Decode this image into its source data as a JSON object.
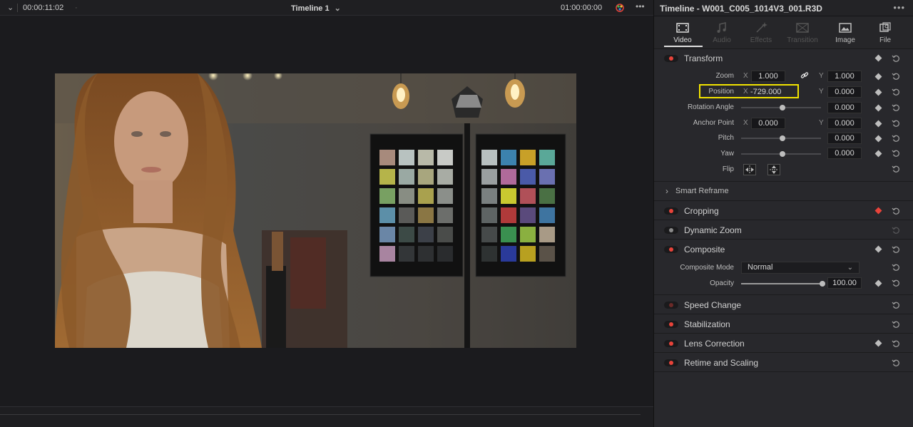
{
  "viewer": {
    "left_dropdown_chevron": "⌄",
    "timecode_left": "00:00:11:02",
    "timeline_name": "Timeline 1",
    "timeline_chevron": "⌄",
    "timecode_right": "01:00:00:00",
    "menu_dots": "•••"
  },
  "inspector": {
    "title": "Timeline - W001_C005_1014V3_001.R3D",
    "menu_dots": "•••",
    "tabs": [
      {
        "label": "Video",
        "icon": "film-icon",
        "state": "active"
      },
      {
        "label": "Audio",
        "icon": "music-note-icon",
        "state": "disabled"
      },
      {
        "label": "Effects",
        "icon": "magic-wand-icon",
        "state": "disabled"
      },
      {
        "label": "Transition",
        "icon": "transition-icon",
        "state": "disabled"
      },
      {
        "label": "Image",
        "icon": "image-icon",
        "state": "enabled"
      },
      {
        "label": "File",
        "icon": "file-icon",
        "state": "enabled"
      }
    ],
    "transform": {
      "label": "Transform",
      "zoom_label": "Zoom",
      "zoom_x_axis": "X",
      "zoom_x": "1.000",
      "zoom_y_axis": "Y",
      "zoom_y": "1.000",
      "position_label": "Position",
      "position_x_axis": "X",
      "position_x": "-729.000",
      "position_y_axis": "Y",
      "position_y": "0.000",
      "rotation_label": "Rotation Angle",
      "rotation": "0.000",
      "anchor_label": "Anchor Point",
      "anchor_x_axis": "X",
      "anchor_x": "0.000",
      "anchor_y_axis": "Y",
      "anchor_y": "0.000",
      "pitch_label": "Pitch",
      "pitch": "0.000",
      "yaw_label": "Yaw",
      "yaw": "0.000",
      "flip_label": "Flip"
    },
    "smart_reframe": {
      "label": "Smart Reframe",
      "chevron": "›"
    },
    "cropping": {
      "label": "Cropping"
    },
    "dynamic_zoom": {
      "label": "Dynamic Zoom"
    },
    "composite": {
      "label": "Composite",
      "mode_label": "Composite Mode",
      "mode_value": "Normal",
      "chevron": "⌄",
      "opacity_label": "Opacity",
      "opacity": "100.00"
    },
    "speed_change": {
      "label": "Speed Change"
    },
    "stabilization": {
      "label": "Stabilization"
    },
    "lens_correction": {
      "label": "Lens Correction"
    },
    "retime_scaling": {
      "label": "Retime and Scaling"
    },
    "colors": {
      "accent_red": "#e8433a",
      "highlight_yellow": "#f2e400"
    }
  }
}
